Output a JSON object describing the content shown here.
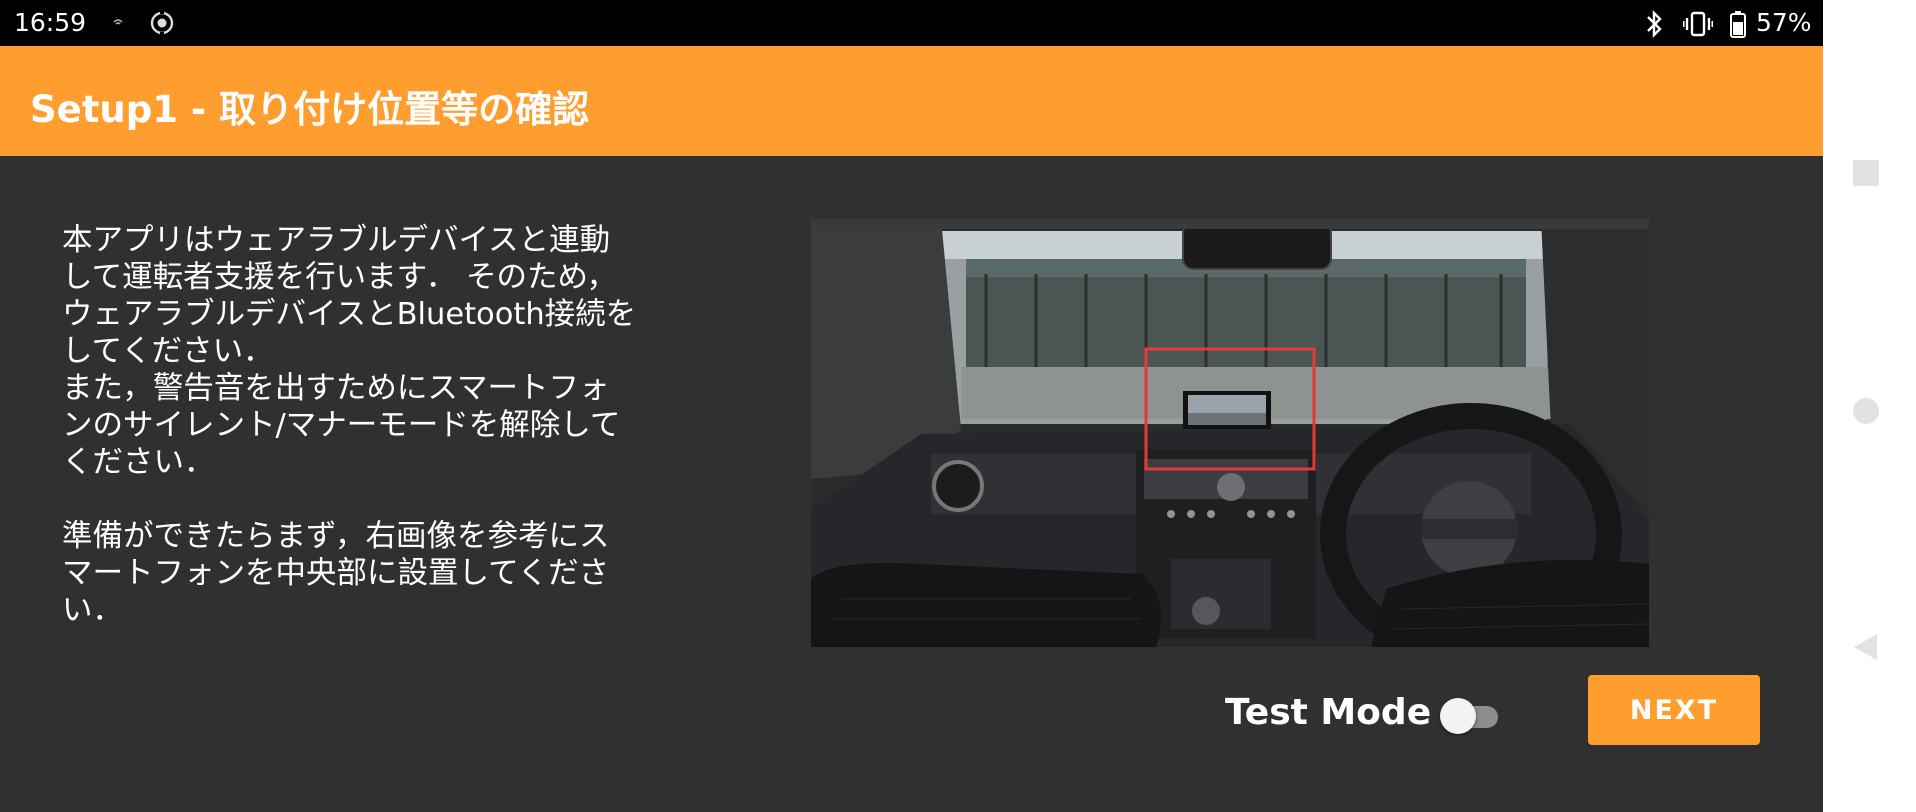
{
  "status_bar": {
    "time": "16:59",
    "battery_percent": "57%",
    "icons": [
      "cast-icon",
      "location-icon",
      "bluetooth-icon",
      "vibrate-icon",
      "battery-icon"
    ]
  },
  "app_bar": {
    "title": "Setup1 - 取り付け位置等の確認",
    "color": "#ff9d2f"
  },
  "main": {
    "description": "本アプリはウェアラブルデバイスと連動\nして運転者支援を行います． そのため，\nウェアラブルデバイスとBluetooth接続を\nしてください．\nまた，警告音を出すためにスマートフォ\nンのサイレント/マナーモードを解除して\nください．\n\n準備ができたらまず，右画像を参考にス\nマートフォンを中央部に設置してくださ\nい．",
    "image": "car-dashboard-photo",
    "highlight_color": "#e53935"
  },
  "controls": {
    "test_mode_label": "Test Mode",
    "test_mode_on": false,
    "next_label": "NEXT"
  },
  "nav_bar": {
    "icons": [
      "recents-icon",
      "home-icon",
      "back-icon"
    ]
  }
}
